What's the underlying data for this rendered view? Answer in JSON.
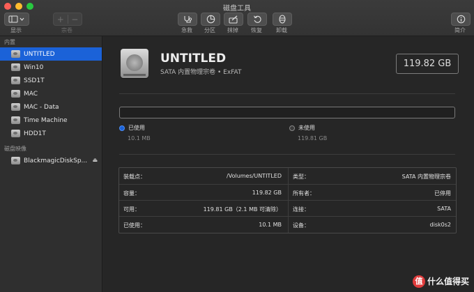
{
  "window": {
    "title": "磁盘工具"
  },
  "toolbar": {
    "view_label": "显示",
    "volume_label": "宗卷",
    "add_symbol": "+",
    "remove_symbol": "−",
    "first_aid_label": "急救",
    "partition_label": "分区",
    "erase_label": "抹掉",
    "restore_label": "恢复",
    "unmount_label": "卸载",
    "info_label": "简介"
  },
  "sidebar": {
    "internal_header": "内置",
    "internal_items": [
      {
        "label": "UNTITLED",
        "selected": true
      },
      {
        "label": "Win10"
      },
      {
        "label": "SSD1T"
      },
      {
        "label": "MAC"
      },
      {
        "label": "MAC - Data"
      },
      {
        "label": "Time Machine"
      },
      {
        "label": "HDD1T"
      }
    ],
    "images_header": "磁盘映像",
    "image_items": [
      {
        "label": "BlackmagicDiskSp...",
        "eject": "⏏"
      }
    ]
  },
  "volume": {
    "name": "UNTITLED",
    "subtitle": "SATA 内置物理宗卷 • ExFAT",
    "capacity": "119.82 GB"
  },
  "usage": {
    "used_label": "已使用",
    "used_value": "10.1 MB",
    "free_label": "未使用",
    "free_value": "119.81 GB",
    "used_color": "#1b62d8"
  },
  "info": {
    "left": [
      {
        "key": "装载点：",
        "value": "/Volumes/UNTITLED"
      },
      {
        "key": "容量：",
        "value": "119.82 GB"
      },
      {
        "key": "可用：",
        "value": "119.81 GB（2.1 MB 可清除）"
      },
      {
        "key": "已使用：",
        "value": "10.1 MB"
      }
    ],
    "right": [
      {
        "key": "类型：",
        "value": "SATA 内置物理宗卷"
      },
      {
        "key": "所有者：",
        "value": "已停用"
      },
      {
        "key": "连接：",
        "value": "SATA"
      },
      {
        "key": "设备：",
        "value": "disk0s2"
      }
    ]
  },
  "watermark": {
    "badge": "值",
    "text": "什么值得买"
  }
}
